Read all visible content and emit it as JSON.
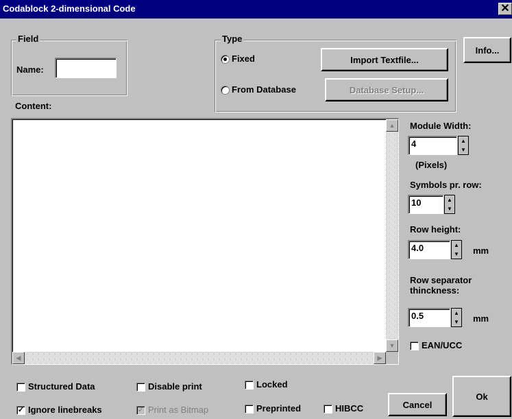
{
  "window": {
    "title": "Codablock 2-dimensional Code",
    "close_glyph": "✕"
  },
  "field_group": {
    "legend": "Field",
    "name_label": "Name:",
    "name_value": ""
  },
  "type_group": {
    "legend": "Type",
    "fixed_label": "Fixed",
    "database_label": "From Database",
    "selected": "Fixed",
    "import_button": "Import Textfile...",
    "database_setup_button": "Database Setup..."
  },
  "info_button": "Info...",
  "content": {
    "label": "Content:",
    "value": ""
  },
  "module_width": {
    "label": "Module Width:",
    "value": "4",
    "unit": "(Pixels)"
  },
  "symbols_per_row": {
    "label": "Symbols pr. row:",
    "value": "10"
  },
  "row_height": {
    "label": "Row height:",
    "value": "4.0",
    "unit": "mm"
  },
  "row_separator": {
    "label_line1": "Row separator",
    "label_line2": "thinckness:",
    "value": "0.5",
    "unit": "mm"
  },
  "ean_ucc": {
    "label": "EAN/UCC",
    "checked": false
  },
  "checkboxes": {
    "structured_data": {
      "label": "Structured Data",
      "checked": false
    },
    "disable_print": {
      "label": "Disable print",
      "checked": false
    },
    "locked": {
      "label": "Locked",
      "checked": false
    },
    "ignore_linebreaks": {
      "label": "Ignore linebreaks",
      "checked": true
    },
    "print_as_bitmap": {
      "label": "Print as Bitmap",
      "checked": true,
      "disabled": true
    },
    "preprinted": {
      "label": "Preprinted",
      "checked": false
    },
    "hibcc": {
      "label": "HIBCC",
      "checked": false
    }
  },
  "buttons": {
    "cancel": "Cancel",
    "ok": "Ok"
  },
  "icons": {
    "check_mark": "✓",
    "spin_up": "▲",
    "spin_down": "▼",
    "scroll_up": "▲",
    "scroll_down": "▼",
    "scroll_left": "◀",
    "scroll_right": "▶"
  }
}
